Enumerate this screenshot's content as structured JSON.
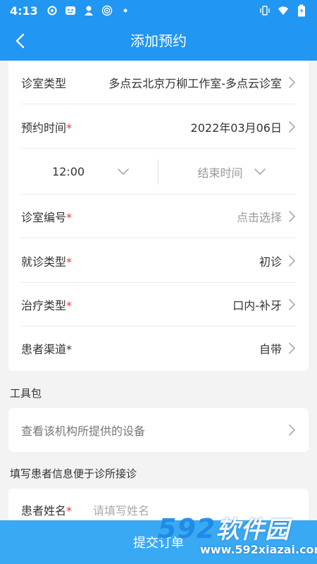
{
  "status_bar": {
    "time": "4:13",
    "left_icons": [
      "record-icon",
      "app-face-icon",
      "person-icon",
      "broadcast-icon",
      "dot-icon"
    ],
    "right_icons": [
      "vibrate-icon",
      "wifi-icon",
      "battery-icon"
    ]
  },
  "header": {
    "title": "添加预约"
  },
  "form": {
    "clinic_type": {
      "label": "诊室类型",
      "value": "多点云北京万柳工作室-多点云诊室"
    },
    "appointment_time": {
      "label": "预约时间",
      "required_mark": "*",
      "value": "2022年03月06日"
    },
    "time_range": {
      "start": "12:00",
      "end": "结束时间"
    },
    "room_number": {
      "label": "诊室编号",
      "required_mark": "*",
      "value": "点击选择"
    },
    "visit_type": {
      "label": "就诊类型",
      "required_mark": "*",
      "value": "初诊"
    },
    "treatment_type": {
      "label": "治疗类型",
      "required_mark": "*",
      "value": "口内-补牙"
    },
    "patient_channel": {
      "label": "患者渠道*",
      "value": "自带"
    }
  },
  "toolkit": {
    "section_title": "工具包",
    "item_label": "查看该机构所提供的设备"
  },
  "patient_info": {
    "section_title": "填写患者信息便于诊所接诊",
    "name_label": "患者姓名",
    "required_mark": "*",
    "name_placeholder": "请填写姓名"
  },
  "submit": {
    "label": "提交订单"
  },
  "watermark": {
    "brand_digits": "592",
    "brand_text": "软件园",
    "site": "www.592xiazai.com"
  },
  "colors": {
    "primary": "#2196f3",
    "submit": "#3aa9f3",
    "required": "#e53935"
  }
}
